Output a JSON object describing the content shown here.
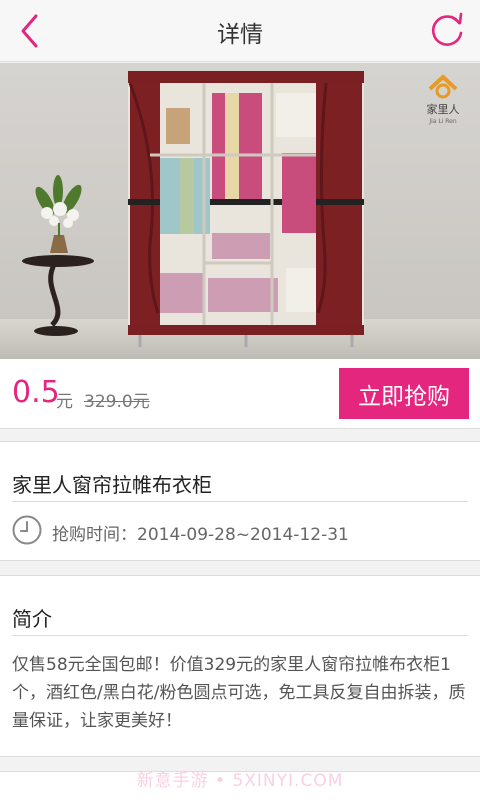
{
  "header": {
    "title": "详情",
    "accent_color": "#e5267f",
    "back_icon": "chevron-left-icon",
    "refresh_icon": "refresh-icon"
  },
  "product_image": {
    "brand_logo_text": "家里人",
    "brand_logo_subtext": "Jia Li Ren"
  },
  "price_bar": {
    "price": "0.5",
    "unit": "元",
    "original_price": "329.0元",
    "buy_button_label": "立即抢购"
  },
  "info": {
    "product_name": "家里人窗帘拉帷布衣柜",
    "time_label": "抢购时间：2014-09-28~2014-12-31"
  },
  "intro": {
    "title": "简介",
    "text": "仅售58元全国包邮！价值329元的家里人窗帘拉帷布衣柜1个，酒红色/黑白花/粉色圆点可选，免工具反复自由拆装，质量保证，让家更美好！"
  },
  "watermark": "新意手游 • 5XINYI.COM"
}
